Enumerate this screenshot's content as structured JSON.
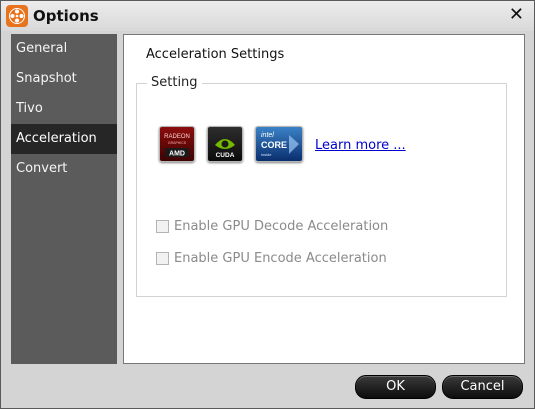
{
  "window": {
    "title": "Options"
  },
  "sidebar": {
    "items": [
      {
        "label": "General"
      },
      {
        "label": "Snapshot"
      },
      {
        "label": "Tivo"
      },
      {
        "label": "Acceleration",
        "selected": true
      },
      {
        "label": "Convert"
      }
    ]
  },
  "main": {
    "heading": "Acceleration Settings",
    "group_label": "Setting",
    "logos": {
      "amd": {
        "line1": "RADEON",
        "line2": "GRAPHICS",
        "line3": "AMD"
      },
      "cuda": {
        "line1": "CUDA"
      },
      "intel": {
        "line1": "intel",
        "line2": "CORE",
        "line3": "inside"
      }
    },
    "learn_more": "Learn more ...",
    "options": [
      {
        "label": "Enable GPU Decode Acceleration",
        "checked": false,
        "enabled": false
      },
      {
        "label": "Enable GPU Encode Acceleration",
        "checked": false,
        "enabled": false
      }
    ]
  },
  "buttons": {
    "ok": "OK",
    "cancel": "Cancel"
  },
  "colors": {
    "sidebar_bg": "#5b5b5b",
    "sidebar_active": "#262626",
    "link": "#0000cc"
  }
}
